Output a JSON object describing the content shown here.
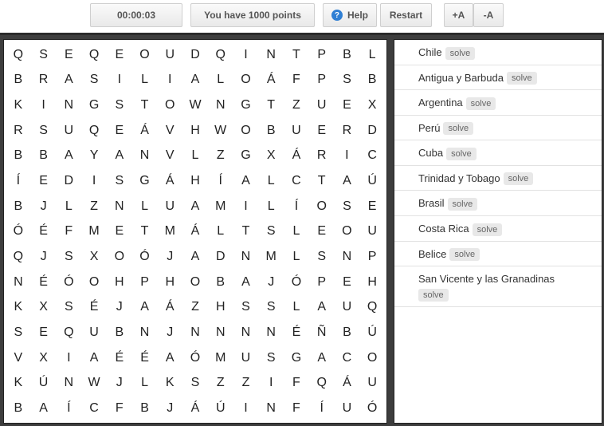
{
  "toolbar": {
    "timer": "00:00:03",
    "points": "You have 1000 points",
    "help_label": "Help",
    "restart_label": "Restart",
    "font_increase_label": "+A",
    "font_decrease_label": "-A"
  },
  "grid": [
    [
      "Q",
      "S",
      "E",
      "Q",
      "E",
      "O",
      "U",
      "D",
      "Q",
      "I",
      "N",
      "T",
      "P",
      "B",
      "L"
    ],
    [
      "B",
      "R",
      "A",
      "S",
      "I",
      "L",
      "I",
      "A",
      "L",
      "O",
      "Á",
      "F",
      "P",
      "S",
      "B"
    ],
    [
      "K",
      "I",
      "N",
      "G",
      "S",
      "T",
      "O",
      "W",
      "N",
      "G",
      "T",
      "Z",
      "U",
      "E",
      "X"
    ],
    [
      "R",
      "S",
      "U",
      "Q",
      "E",
      "Á",
      "V",
      "H",
      "W",
      "O",
      "B",
      "U",
      "E",
      "R",
      "D"
    ],
    [
      "B",
      "B",
      "A",
      "Y",
      "A",
      "N",
      "V",
      "L",
      "Z",
      "G",
      "X",
      "Á",
      "R",
      "I",
      "C"
    ],
    [
      "Í",
      "E",
      "D",
      "I",
      "S",
      "G",
      "Á",
      "H",
      "Í",
      "A",
      "L",
      "C",
      "T",
      "A",
      "Ú"
    ],
    [
      "B",
      "J",
      "L",
      "Z",
      "N",
      "L",
      "U",
      "A",
      "M",
      "I",
      "L",
      "Í",
      "O",
      "S",
      "E"
    ],
    [
      "Ó",
      "É",
      "F",
      "M",
      "E",
      "T",
      "M",
      "Á",
      "L",
      "T",
      "S",
      "L",
      "E",
      "O",
      "U"
    ],
    [
      "Q",
      "J",
      "S",
      "X",
      "O",
      "Ó",
      "J",
      "A",
      "D",
      "N",
      "M",
      "L",
      "S",
      "N",
      "P"
    ],
    [
      "N",
      "É",
      "Ó",
      "O",
      "H",
      "P",
      "H",
      "O",
      "B",
      "A",
      "J",
      "Ó",
      "P",
      "E",
      "H"
    ],
    [
      "K",
      "X",
      "S",
      "É",
      "J",
      "A",
      "Á",
      "Z",
      "H",
      "S",
      "S",
      "L",
      "A",
      "U",
      "Q"
    ],
    [
      "S",
      "E",
      "Q",
      "U",
      "B",
      "N",
      "J",
      "N",
      "N",
      "N",
      "N",
      "É",
      "Ñ",
      "B",
      "Ú"
    ],
    [
      "V",
      "X",
      "I",
      "A",
      "É",
      "É",
      "A",
      "Ó",
      "M",
      "U",
      "S",
      "G",
      "A",
      "C",
      "O"
    ],
    [
      "K",
      "Ú",
      "N",
      "W",
      "J",
      "L",
      "K",
      "S",
      "Z",
      "Z",
      "I",
      "F",
      "Q",
      "Á",
      "U"
    ],
    [
      "B",
      "A",
      "Í",
      "C",
      "F",
      "B",
      "J",
      "Á",
      "Ú",
      "I",
      "N",
      "F",
      "Í",
      "U",
      "Ó"
    ]
  ],
  "words": [
    {
      "name": "Chile",
      "solve": "solve"
    },
    {
      "name": "Antigua y Barbuda",
      "solve": "solve"
    },
    {
      "name": "Argentina",
      "solve": "solve"
    },
    {
      "name": "Perú",
      "solve": "solve"
    },
    {
      "name": "Cuba",
      "solve": "solve"
    },
    {
      "name": "Trinidad y Tobago",
      "solve": "solve"
    },
    {
      "name": "Brasil",
      "solve": "solve"
    },
    {
      "name": "Costa Rica",
      "solve": "solve"
    },
    {
      "name": "Belice",
      "solve": "solve"
    },
    {
      "name": "San Vicente y las Granadinas",
      "solve": "solve"
    }
  ]
}
